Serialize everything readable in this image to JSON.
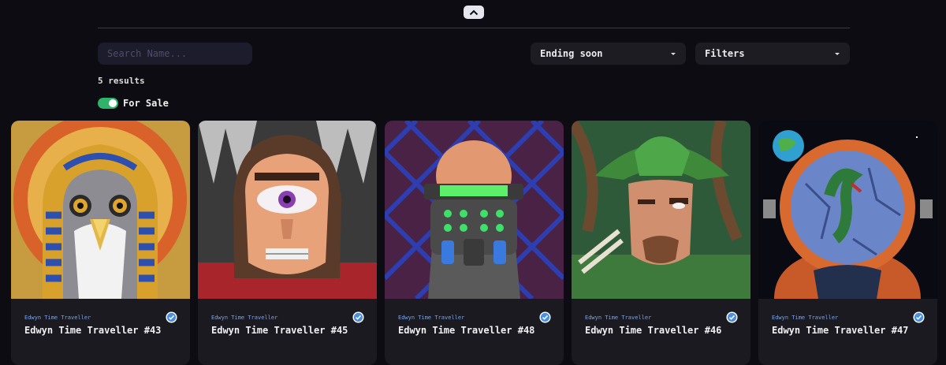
{
  "search": {
    "placeholder": "Search Name..."
  },
  "sort": {
    "label": "Ending soon"
  },
  "filters": {
    "label": "Filters"
  },
  "results": {
    "count_text": "5 results"
  },
  "for_sale": {
    "label": "For Sale",
    "enabled": true
  },
  "colors": {
    "accent_green": "#2fb36a",
    "verified_blue": "#4a90e2",
    "collection_text": "#7da4e6"
  },
  "cards": [
    {
      "collection": "Edwyn Time Traveller",
      "title": "Edwyn Time Traveller #43",
      "art": "pharaoh-falcon"
    },
    {
      "collection": "Edwyn Time Traveller",
      "title": "Edwyn Time Traveller #45",
      "art": "cyclops-man"
    },
    {
      "collection": "Edwyn Time Traveller",
      "title": "Edwyn Time Traveller #48",
      "art": "cyber-soldier"
    },
    {
      "collection": "Edwyn Time Traveller",
      "title": "Edwyn Time Traveller #46",
      "art": "green-archer"
    },
    {
      "collection": "Edwyn Time Traveller",
      "title": "Edwyn Time Traveller #47",
      "art": "cracked-globe-astronaut"
    }
  ]
}
